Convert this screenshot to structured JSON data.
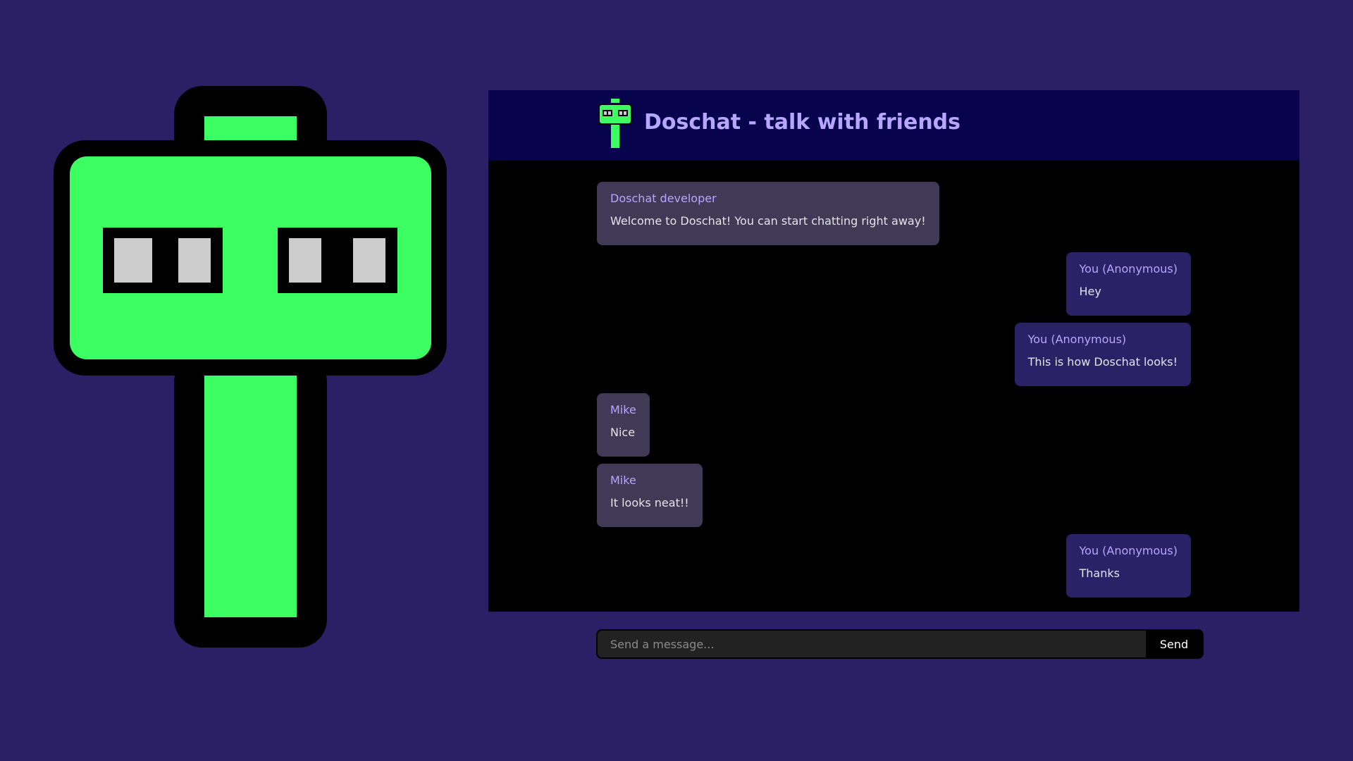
{
  "app": {
    "title": "Doschat - talk with friends",
    "logo_icon": "robot-mascot-icon",
    "colors": {
      "background": "#2b2066",
      "header": "#07034d",
      "accent": "#b7a6ff",
      "mascot_green": "#3cff62",
      "incoming_bubble": "#403a56",
      "outgoing_bubble": "#2b2166"
    }
  },
  "messages": [
    {
      "author": "Doschat developer",
      "text": "Welcome to Doschat! You can start chatting right away!",
      "direction": "incoming"
    },
    {
      "author": "You (Anonymous)",
      "text": "Hey",
      "direction": "outgoing"
    },
    {
      "author": "You (Anonymous)",
      "text": "This is how Doschat looks!",
      "direction": "outgoing"
    },
    {
      "author": "Mike",
      "text": "Nice",
      "direction": "incoming"
    },
    {
      "author": "Mike",
      "text": "It looks neat!!",
      "direction": "incoming"
    },
    {
      "author": "You (Anonymous)",
      "text": "Thanks",
      "direction": "outgoing"
    }
  ],
  "composer": {
    "placeholder": "Send a message...",
    "value": "",
    "send_label": "Send"
  }
}
